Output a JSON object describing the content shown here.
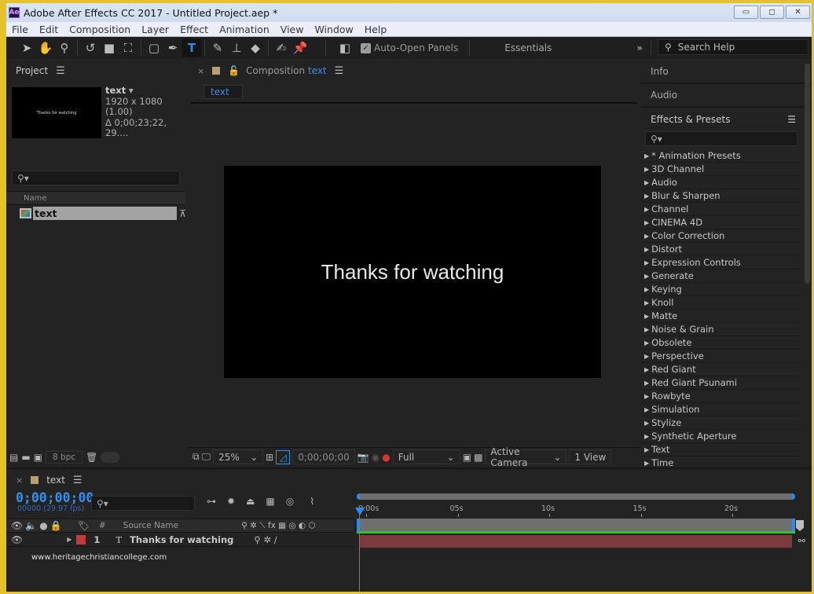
{
  "window": {
    "title": "Adobe After Effects CC 2017 - Untitled Project.aep *",
    "app_icon": "Ae",
    "controls": [
      "minimize",
      "restore",
      "close"
    ]
  },
  "menu": [
    "File",
    "Edit",
    "Composition",
    "Layer",
    "Effect",
    "Animation",
    "View",
    "Window",
    "Help"
  ],
  "toolbar": {
    "tools": [
      "selection-tool",
      "hand-tool",
      "zoom-tool",
      "rotation-tool",
      "camera-tool",
      "pan-behind-tool",
      "rectangle-tool",
      "pen-tool",
      "type-tool",
      "brush-tool",
      "clone-stamp-tool",
      "eraser-tool",
      "roto-brush-tool",
      "puppet-pin-tool"
    ],
    "active_tool": "type-tool",
    "auto_open_label": "Auto-Open Panels",
    "auto_open_checked": true,
    "workspace": "Essentials",
    "search_placeholder": "Search Help"
  },
  "project": {
    "title": "Project",
    "item_name": "text",
    "dimensions": "1920 x 1080 (1.00)",
    "duration": "Δ 0;00;23;22, 29....",
    "thumb_text": "Thanks for watching",
    "column_name": "Name",
    "items": [
      {
        "name": "text",
        "type": "composition",
        "selected": true
      }
    ],
    "bpc": "8 bpc"
  },
  "composition": {
    "tab_prefix": "Composition",
    "tab_name": "text",
    "breadcrumb": "text",
    "canvas_text": "Thanks for watching",
    "zoom": "25%",
    "timecode": "0;00;00;00",
    "resolution": "Full",
    "camera": "Active Camera",
    "views": "1 View"
  },
  "right": {
    "info": "Info",
    "audio": "Audio",
    "effects_title": "Effects & Presets",
    "effects": [
      "* Animation Presets",
      "3D Channel",
      "Audio",
      "Blur & Sharpen",
      "Channel",
      "CINEMA 4D",
      "Color Correction",
      "Distort",
      "Expression Controls",
      "Generate",
      "Keying",
      "Knoll",
      "Matte",
      "Noise & Grain",
      "Obsolete",
      "Perspective",
      "Red Giant",
      "Red Giant Psunami",
      "Rowbyte",
      "Simulation",
      "Stylize",
      "Synthetic Aperture",
      "Text",
      "Time"
    ]
  },
  "timeline": {
    "tab": "text",
    "timecode": "0;00;00;00",
    "fps": "00000 (29.97 fps)",
    "col_num": "#",
    "col_source": "Source Name",
    "ruler": [
      "0:00s",
      "05s",
      "10s",
      "15s",
      "20s"
    ],
    "layers": [
      {
        "num": "1",
        "type": "T",
        "name": "Thanks for watching",
        "label_color": "#c0393b"
      }
    ]
  },
  "watermark": "www.heritagechristiancollege.com",
  "colors": {
    "accent": "#2d8ceb",
    "layer_bar": "#7b3b3c",
    "work_area": "#3bbf3b"
  }
}
